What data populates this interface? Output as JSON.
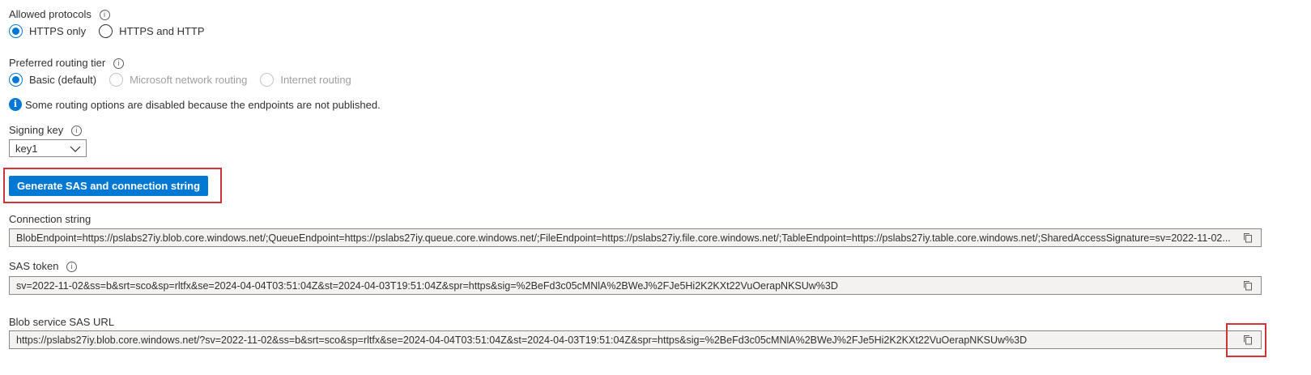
{
  "allowed_protocols": {
    "label": "Allowed protocols",
    "options": [
      {
        "label": "HTTPS only",
        "checked": true,
        "disabled": false
      },
      {
        "label": "HTTPS and HTTP",
        "checked": false,
        "disabled": false
      }
    ]
  },
  "routing_tier": {
    "label": "Preferred routing tier",
    "options": [
      {
        "label": "Basic (default)",
        "checked": true,
        "disabled": false
      },
      {
        "label": "Microsoft network routing",
        "checked": false,
        "disabled": true
      },
      {
        "label": "Internet routing",
        "checked": false,
        "disabled": true
      }
    ],
    "info_message": "Some routing options are disabled because the endpoints are not published."
  },
  "signing_key": {
    "label": "Signing key",
    "selected": "key1"
  },
  "generate_button": {
    "label": "Generate SAS and connection string"
  },
  "connection_string": {
    "label": "Connection string",
    "value": "BlobEndpoint=https://pslabs27iy.blob.core.windows.net/;QueueEndpoint=https://pslabs27iy.queue.core.windows.net/;FileEndpoint=https://pslabs27iy.file.core.windows.net/;TableEndpoint=https://pslabs27iy.table.core.windows.net/;SharedAccessSignature=sv=2022-11-02..."
  },
  "sas_token": {
    "label": "SAS token",
    "value": "sv=2022-11-02&ss=b&srt=sco&sp=rltfx&se=2024-04-04T03:51:04Z&st=2024-04-03T19:51:04Z&spr=https&sig=%2BeFd3c05cMNlA%2BWeJ%2FJe5Hi2K2KXt22VuOerapNKSUw%3D"
  },
  "blob_sas_url": {
    "label": "Blob service SAS URL",
    "value": "https://pslabs27iy.blob.core.windows.net/?sv=2022-11-02&ss=b&srt=sco&sp=rltfx&se=2024-04-04T03:51:04Z&st=2024-04-03T19:51:04Z&spr=https&sig=%2BeFd3c05cMNlA%2BWeJ%2FJe5Hi2K2KXt22VuOerapNKSUw%3D"
  },
  "icons": {
    "info": "info-icon",
    "copy": "copy-icon",
    "dropdown": "chevron-down-icon"
  },
  "colors": {
    "accent": "#0078d4",
    "highlight": "#d13438"
  }
}
